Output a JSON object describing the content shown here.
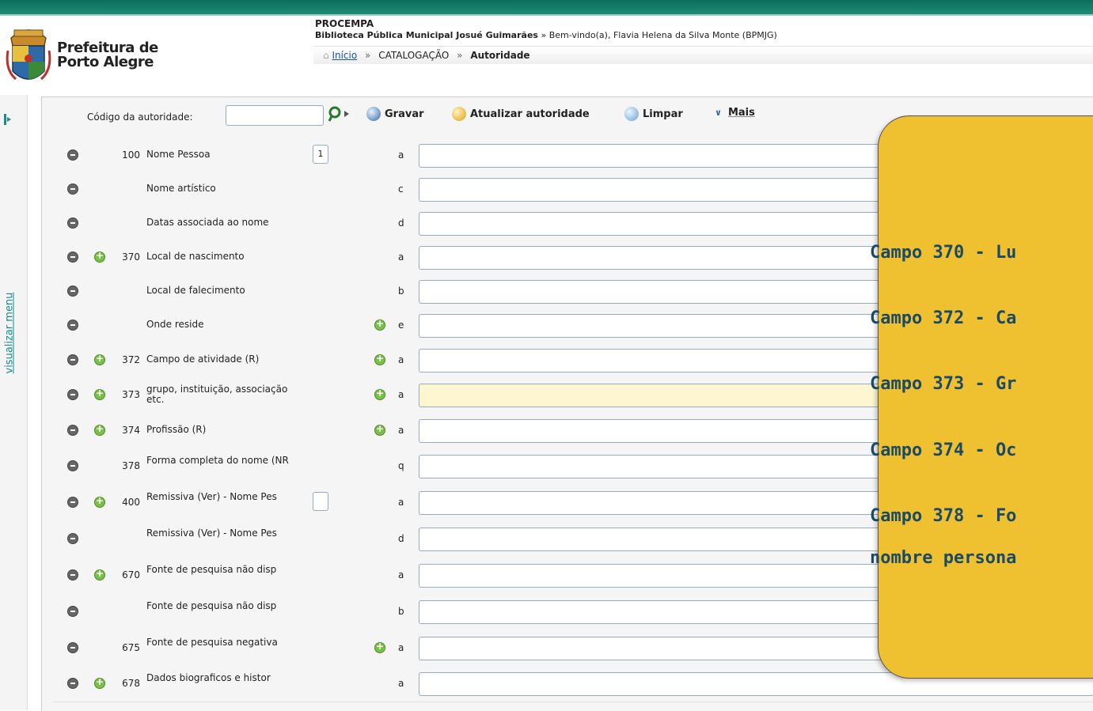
{
  "header": {
    "brand_line1": "Prefeitura de",
    "brand_line2": "Porto Alegre",
    "org": "PROCEMPA",
    "library_bold": "Biblioteca Pública Municipal Josué Guimarães",
    "library_rest": " » Bem-vindo(a), Flavia Helena da Silva Monte (BPMJG)"
  },
  "breadcrumb": {
    "home": "Início",
    "sep": "»",
    "section": "CATALOGAÇÃO",
    "current": "Autoridade"
  },
  "sidebar": {
    "toggle_label": "visualizar menu"
  },
  "toolbar": {
    "code_label": "Código da autoridade:",
    "code_value": "",
    "save": "Gravar",
    "update": "Atualizar autoridade",
    "clear": "Limpar",
    "more_arrow": "∨",
    "more": "Mais"
  },
  "fields": [
    {
      "tag": "100",
      "label": "Nome Pessoa",
      "indicator": "1",
      "sub": "a",
      "add": false,
      "add2": false,
      "highlight": false
    },
    {
      "tag": "",
      "label": "Nome artístico",
      "sub": "c",
      "add": false,
      "add2": false
    },
    {
      "tag": "",
      "label": "Datas associada ao nome",
      "sub": "d",
      "add": false,
      "add2": false
    },
    {
      "tag": "370",
      "label": "Local de nascimento",
      "sub": "a",
      "add": true,
      "add2": false
    },
    {
      "tag": "",
      "label": "Local de falecimento",
      "sub": "b",
      "add": false,
      "add2": false
    },
    {
      "tag": "",
      "label": "Onde reside",
      "sub": "e",
      "add": false,
      "add2": true
    },
    {
      "tag": "372",
      "label": "Campo de atividade (R)",
      "sub": "a",
      "add": true,
      "add2": true
    },
    {
      "tag": "373",
      "label": "grupo, instituição, associação etc.",
      "sub": "a",
      "add": true,
      "add2": true,
      "highlight": true
    },
    {
      "tag": "374",
      "label": "Profissão (R)",
      "sub": "a",
      "add": true,
      "add2": true
    },
    {
      "tag": "378",
      "label": "Forma completa do nome (NR",
      "sub": "q",
      "add": false,
      "add2": false
    },
    {
      "tag": "400",
      "label": "Remissiva (Ver) - Nome Pes",
      "indicator": "",
      "sub": "a",
      "add": true,
      "add2": false
    },
    {
      "tag": "",
      "label": "Remissiva (Ver) - Nome Pes",
      "sub": "d",
      "add": false,
      "add2": false
    },
    {
      "tag": "670",
      "label": "Fonte de pesquisa não disp",
      "sub": "a",
      "add": true,
      "add2": false
    },
    {
      "tag": "",
      "label": "Fonte de pesquisa não disp",
      "sub": "b",
      "add": false,
      "add2": false
    },
    {
      "tag": "675",
      "label": "Fonte de pesquisa negativa",
      "sub": "a",
      "add": false,
      "add2": true
    },
    {
      "tag": "678",
      "label": "Dados biograficos e histor",
      "sub": "a",
      "add": true,
      "add2": false
    }
  ],
  "callout": {
    "lines": [
      "Campo 370 - Lu",
      "Campo 372 - Ca",
      "Campo 373 - Gr",
      "Campo 374 - Oc",
      "Campo 378 - Fo",
      "nombre persona"
    ],
    "color": "#efc02f"
  }
}
